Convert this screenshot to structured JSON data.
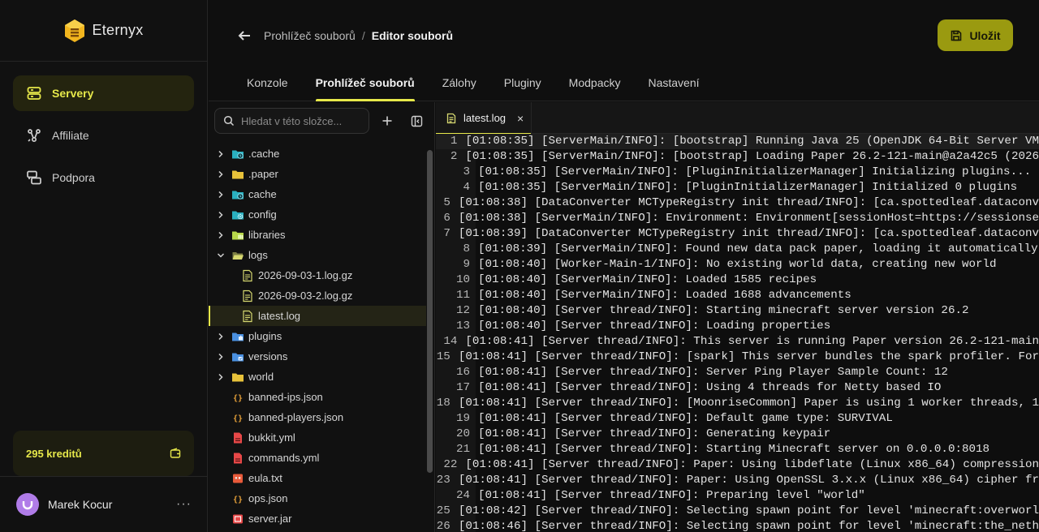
{
  "brand": {
    "name": "Eternyx",
    "accent": "#e6e84a"
  },
  "sidebar": {
    "items": [
      {
        "label": "Servery",
        "icon": "server-icon",
        "active": true
      },
      {
        "label": "Affiliate",
        "icon": "affiliate-icon",
        "active": false
      },
      {
        "label": "Podpora",
        "icon": "support-icon",
        "active": false
      }
    ],
    "credits": "295 kreditů",
    "user": {
      "name": "Marek Kocur",
      "menu": "···"
    }
  },
  "header": {
    "breadcrumb": {
      "parent": "Prohlížeč souborů",
      "separator": "/",
      "current": "Editor souborů"
    },
    "save_label": "Uložit",
    "tabs": [
      {
        "label": "Konzole",
        "active": false
      },
      {
        "label": "Prohlížeč souborů",
        "active": true
      },
      {
        "label": "Zálohy",
        "active": false
      },
      {
        "label": "Pluginy",
        "active": false
      },
      {
        "label": "Modpacky",
        "active": false
      },
      {
        "label": "Nastavení",
        "active": false
      }
    ]
  },
  "tree": {
    "search_placeholder": "Hledat v této složce...",
    "items": [
      {
        "name": ".cache",
        "type": "folder",
        "expanded": false,
        "icon": "folder-clock-icon",
        "color": "#2ab0c0"
      },
      {
        "name": ".paper",
        "type": "folder",
        "expanded": false,
        "icon": "folder-icon",
        "color": "#e8c23a"
      },
      {
        "name": "cache",
        "type": "folder",
        "expanded": false,
        "icon": "folder-clock-icon",
        "color": "#2ab0c0"
      },
      {
        "name": "config",
        "type": "folder",
        "expanded": false,
        "icon": "folder-gear-icon",
        "color": "#2ab0c0"
      },
      {
        "name": "libraries",
        "type": "folder",
        "expanded": false,
        "icon": "folder-lib-icon",
        "color": "#b8d84a"
      },
      {
        "name": "logs",
        "type": "folder",
        "expanded": true,
        "icon": "folder-open-icon",
        "color": "#d6d870"
      },
      {
        "name": "2026-09-03-1.log.gz",
        "type": "file",
        "depth": 1,
        "icon": "log-file-icon",
        "color": "#d6d870"
      },
      {
        "name": "2026-09-03-2.log.gz",
        "type": "file",
        "depth": 1,
        "icon": "log-file-icon",
        "color": "#d6d870"
      },
      {
        "name": "latest.log",
        "type": "file",
        "depth": 1,
        "icon": "log-file-icon",
        "color": "#d6d870",
        "selected": true
      },
      {
        "name": "plugins",
        "type": "folder",
        "expanded": false,
        "icon": "folder-plugin-icon",
        "color": "#4a90e0"
      },
      {
        "name": "versions",
        "type": "folder",
        "expanded": false,
        "icon": "folder-versions-icon",
        "color": "#4a90e0"
      },
      {
        "name": "world",
        "type": "folder",
        "expanded": false,
        "icon": "folder-icon",
        "color": "#e8c23a"
      },
      {
        "name": "banned-ips.json",
        "type": "file",
        "depth": 0,
        "icon": "json-file-icon",
        "color": "#e8a23a"
      },
      {
        "name": "banned-players.json",
        "type": "file",
        "depth": 0,
        "icon": "json-file-icon",
        "color": "#e8a23a"
      },
      {
        "name": "bukkit.yml",
        "type": "file",
        "depth": 0,
        "icon": "yml-file-icon",
        "color": "#e84848"
      },
      {
        "name": "commands.yml",
        "type": "file",
        "depth": 0,
        "icon": "yml-file-icon",
        "color": "#e84848"
      },
      {
        "name": "eula.txt",
        "type": "file",
        "depth": 0,
        "icon": "txt-file-icon",
        "color": "#e85a3a"
      },
      {
        "name": "ops.json",
        "type": "file",
        "depth": 0,
        "icon": "json-file-icon",
        "color": "#e8a23a"
      },
      {
        "name": "server.jar",
        "type": "file",
        "depth": 0,
        "icon": "jar-file-icon",
        "color": "#e84848"
      }
    ]
  },
  "editor": {
    "tab_label": "latest.log",
    "close": "×",
    "lines": [
      "[01:08:35] [ServerMain/INFO]: [bootstrap] Running Java 25 (OpenJDK 64-Bit Server VM",
      "[01:08:35] [ServerMain/INFO]: [bootstrap] Loading Paper 26.2-121-main@a2a42c5 (2026",
      "[01:08:35] [ServerMain/INFO]: [PluginInitializerManager] Initializing plugins...",
      "[01:08:35] [ServerMain/INFO]: [PluginInitializerManager] Initialized 0 plugins",
      "[01:08:38] [DataConverter MCTypeRegistry init thread/INFO]: [ca.spottedleaf.dataconv",
      "[01:08:38] [ServerMain/INFO]: Environment: Environment[sessionHost=https://sessionse",
      "[01:08:39] [DataConverter MCTypeRegistry init thread/INFO]: [ca.spottedleaf.dataconv",
      "[01:08:39] [ServerMain/INFO]: Found new data pack paper, loading it automatically",
      "[01:08:40] [Worker-Main-1/INFO]: No existing world data, creating new world",
      "[01:08:40] [ServerMain/INFO]: Loaded 1585 recipes",
      "[01:08:40] [ServerMain/INFO]: Loaded 1688 advancements",
      "[01:08:40] [Server thread/INFO]: Starting minecraft server version 26.2",
      "[01:08:40] [Server thread/INFO]: Loading properties",
      "[01:08:41] [Server thread/INFO]: This server is running Paper version 26.2-121-main",
      "[01:08:41] [Server thread/INFO]: [spark] This server bundles the spark profiler. For",
      "[01:08:41] [Server thread/INFO]: Server Ping Player Sample Count: 12",
      "[01:08:41] [Server thread/INFO]: Using 4 threads for Netty based IO",
      "[01:08:41] [Server thread/INFO]: [MoonriseCommon] Paper is using 1 worker threads, 1",
      "[01:08:41] [Server thread/INFO]: Default game type: SURVIVAL",
      "[01:08:41] [Server thread/INFO]: Generating keypair",
      "[01:08:41] [Server thread/INFO]: Starting Minecraft server on 0.0.0.0:8018",
      "[01:08:41] [Server thread/INFO]: Paper: Using libdeflate (Linux x86_64) compression",
      "[01:08:41] [Server thread/INFO]: Paper: Using OpenSSL 3.x.x (Linux x86_64) cipher fr",
      "[01:08:41] [Server thread/INFO]: Preparing level \"world\"",
      "[01:08:42] [Server thread/INFO]: Selecting spawn point for level 'minecraft:overworl",
      "[01:08:46] [Server thread/INFO]: Selecting spawn point for level 'minecraft:the_neth"
    ]
  }
}
